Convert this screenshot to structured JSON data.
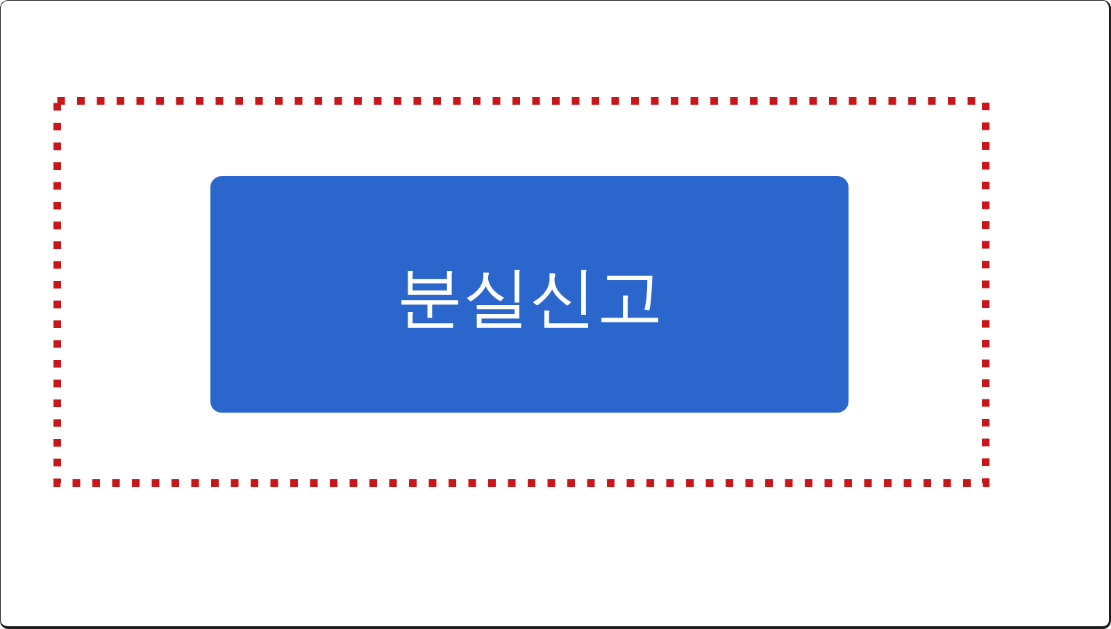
{
  "button": {
    "label": "분실신고"
  }
}
